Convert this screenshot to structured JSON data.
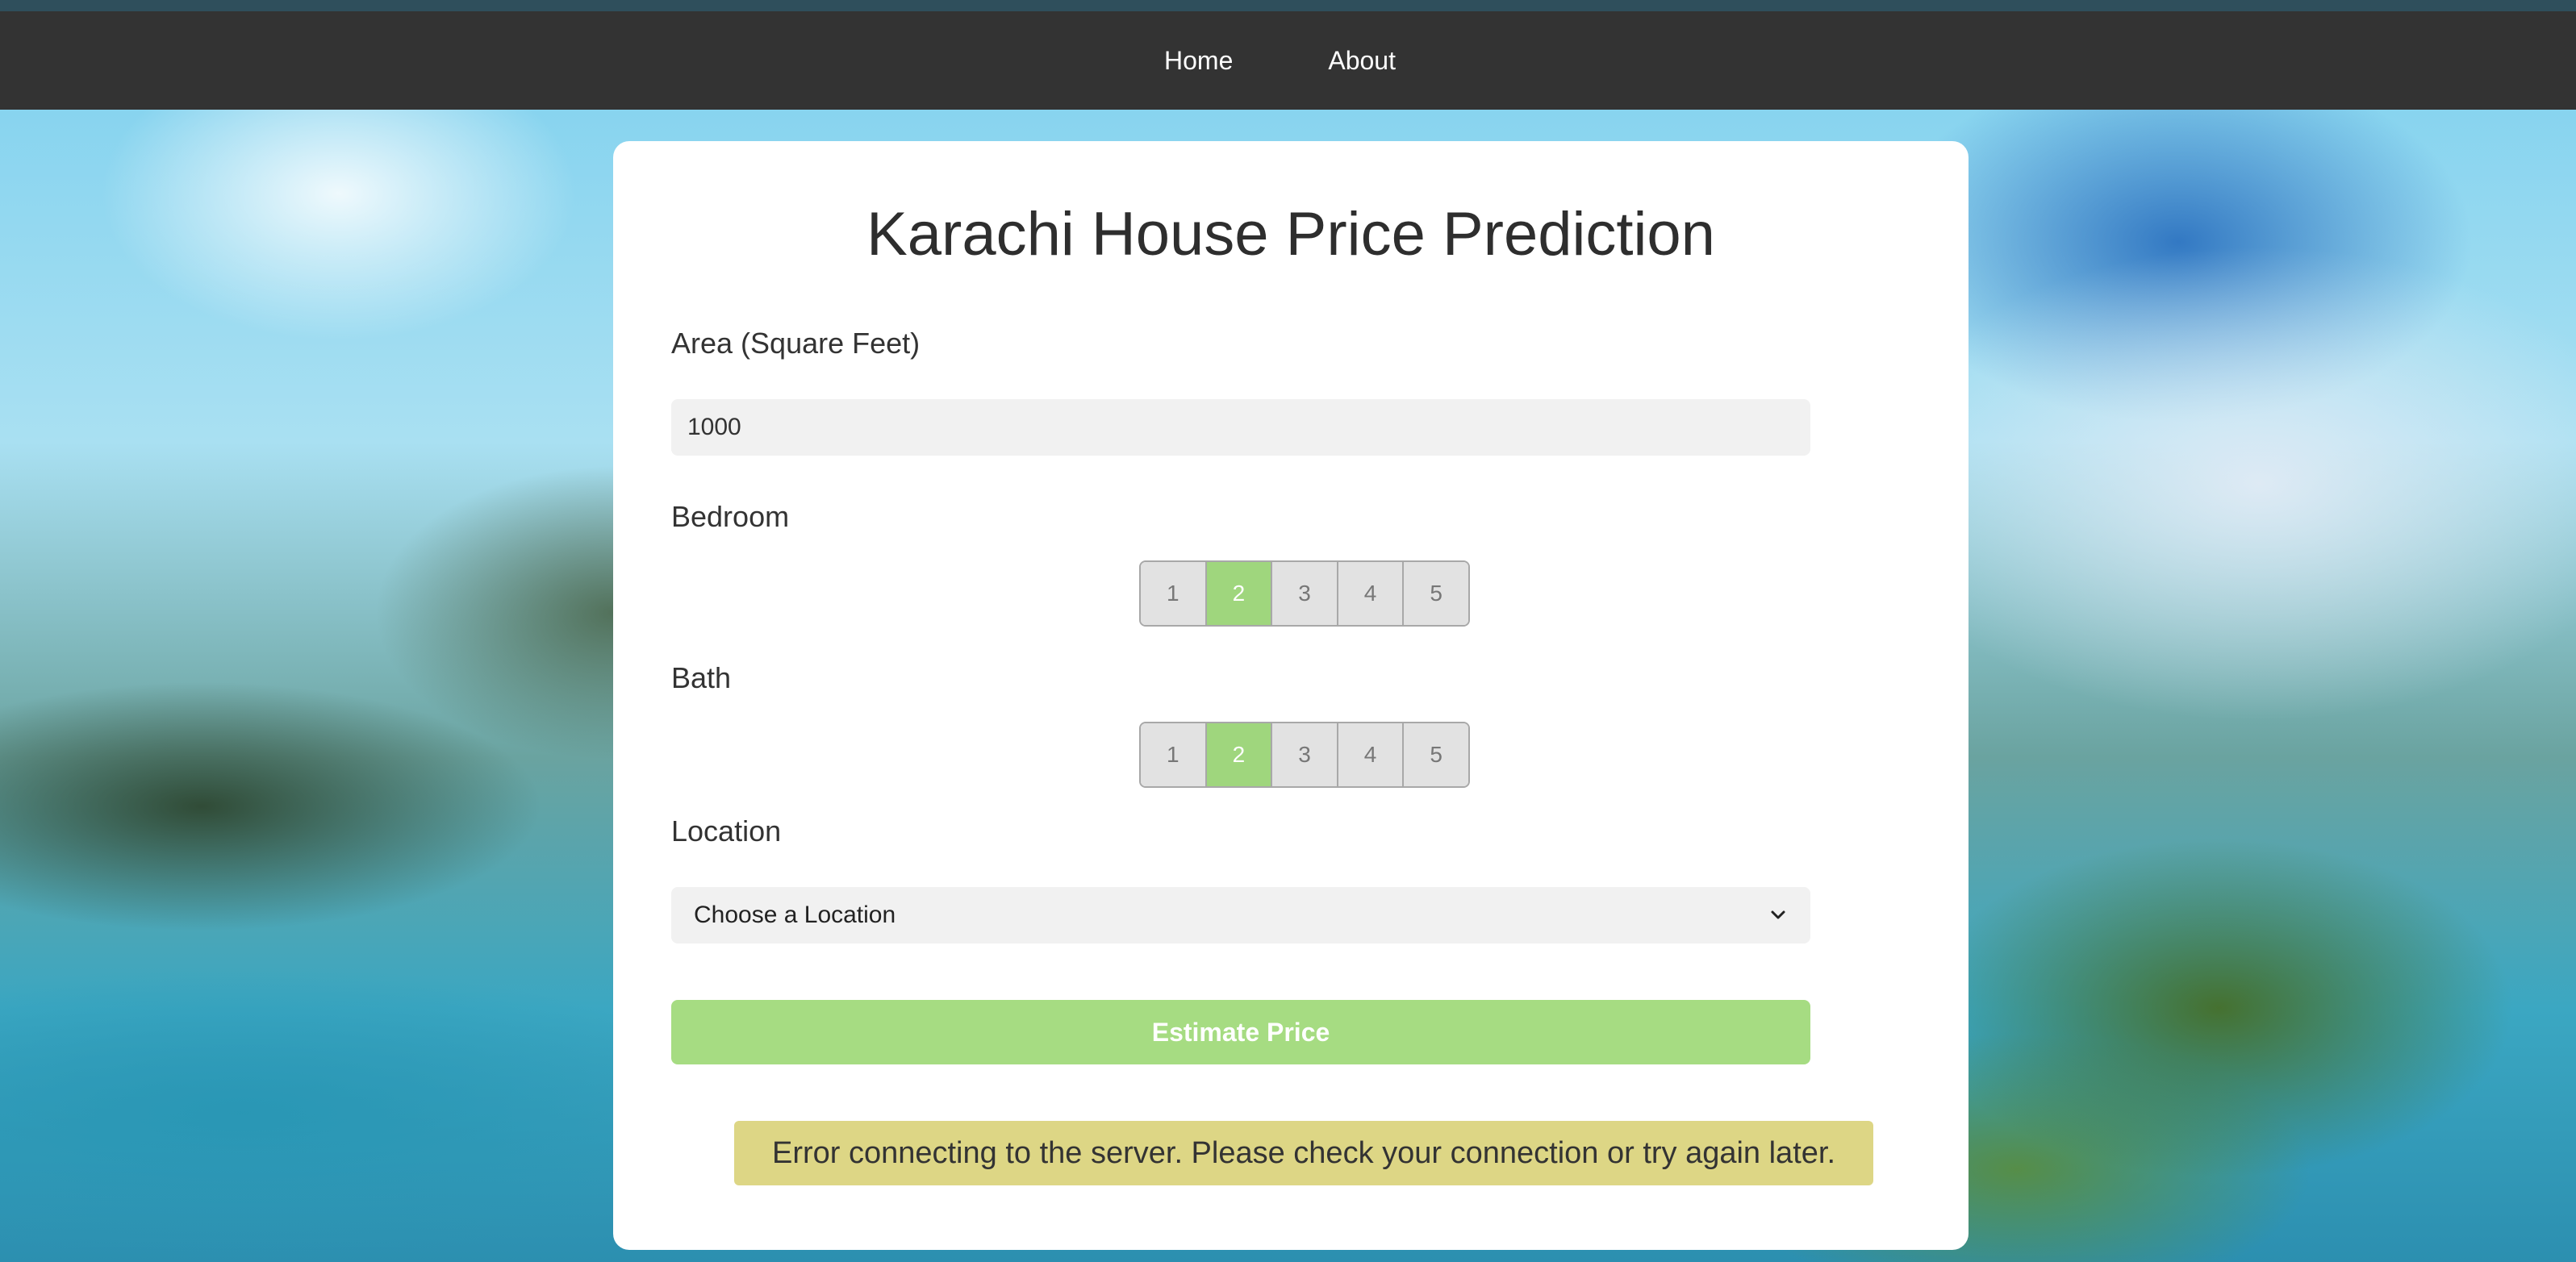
{
  "nav": {
    "links": [
      {
        "label": "Home"
      },
      {
        "label": "About"
      }
    ]
  },
  "form": {
    "title": "Karachi House Price Prediction",
    "area": {
      "label": "Area (Square Feet)",
      "value": "1000"
    },
    "bedroom": {
      "label": "Bedroom",
      "options": [
        "1",
        "2",
        "3",
        "4",
        "5"
      ],
      "selected": "2"
    },
    "bath": {
      "label": "Bath",
      "options": [
        "1",
        "2",
        "3",
        "4",
        "5"
      ],
      "selected": "2"
    },
    "location": {
      "label": "Location",
      "selected_text": "Choose a Location"
    },
    "submit_label": "Estimate Price",
    "error_message": "Error connecting to the server. Please check your connection or try again later."
  },
  "colors": {
    "navbar": "#333333",
    "accent_green": "#9fd67d",
    "button_green": "#a6dc82",
    "error_yellow": "#ddd685"
  }
}
